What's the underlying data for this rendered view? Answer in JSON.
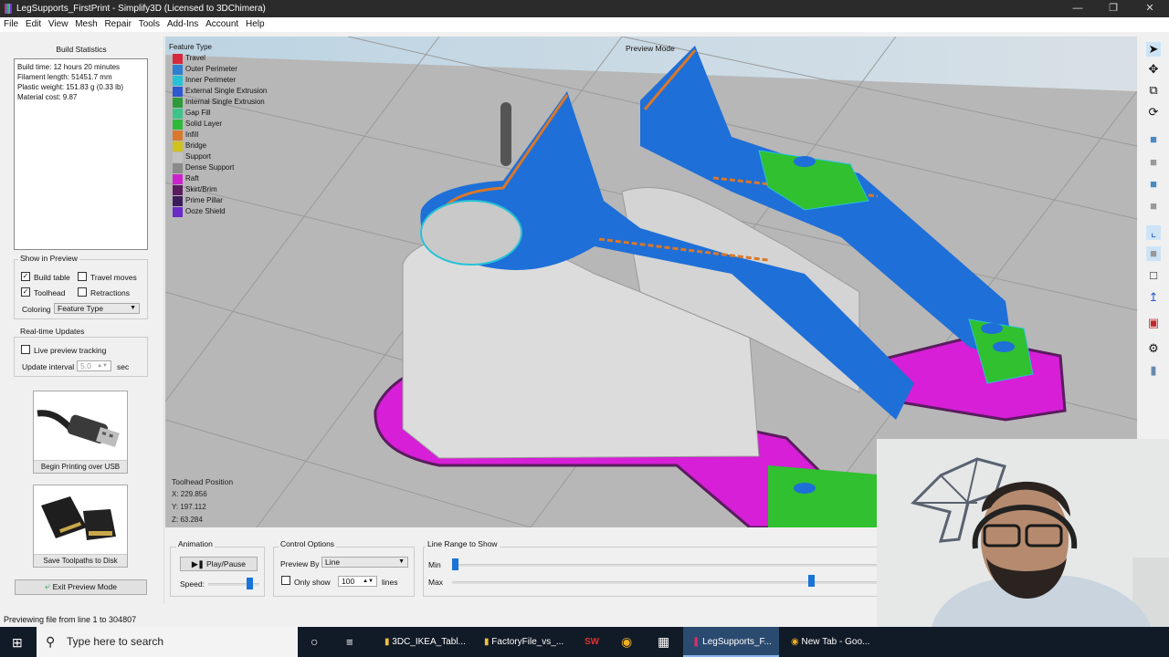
{
  "window": {
    "title": "LegSupports_FirstPrint - Simplify3D (Licensed to 3DChimera)",
    "controls": [
      "minimize",
      "restore",
      "close"
    ]
  },
  "menu": [
    "File",
    "Edit",
    "View",
    "Mesh",
    "Repair",
    "Tools",
    "Add-Ins",
    "Account",
    "Help"
  ],
  "build_statistics": {
    "heading": "Build Statistics",
    "lines": [
      "Build time: 12 hours 20 minutes",
      "Filament length: 51451.7 mm",
      "Plastic weight: 151.83 g (0.33 lb)",
      "Material cost: 9.87"
    ]
  },
  "show_in_preview": {
    "heading": "Show in Preview",
    "build_table": {
      "label": "Build table",
      "checked": true
    },
    "travel_moves": {
      "label": "Travel moves",
      "checked": false
    },
    "toolhead": {
      "label": "Toolhead",
      "checked": true
    },
    "retractions": {
      "label": "Retractions",
      "checked": false
    },
    "coloring_label": "Coloring",
    "coloring_value": "Feature Type"
  },
  "realtime_updates": {
    "heading": "Real-time Updates",
    "live_tracking": {
      "label": "Live preview tracking",
      "checked": false
    },
    "interval_label": "Update interval",
    "interval_value": "5.0",
    "interval_unit": "sec"
  },
  "actions": {
    "usb_label": "Begin Printing over USB",
    "disk_label": "Save Toolpaths to Disk",
    "exit_label": "Exit Preview Mode"
  },
  "status": "Previewing file from line 1 to 304807",
  "viewport": {
    "mode_label": "Preview Mode",
    "legend_title": "Feature Type",
    "legend": [
      {
        "label": "Travel",
        "color": "#d8283c"
      },
      {
        "label": "Outer Perimeter",
        "color": "#2f7fd0"
      },
      {
        "label": "Inner Perimeter",
        "color": "#27c2d6"
      },
      {
        "label": "External Single Extrusion",
        "color": "#2e58d0"
      },
      {
        "label": "Internal Single Extrusion",
        "color": "#2e9a3a"
      },
      {
        "label": "Gap Fill",
        "color": "#3cc48a"
      },
      {
        "label": "Solid Layer",
        "color": "#30b83a"
      },
      {
        "label": "Infill",
        "color": "#d9782a"
      },
      {
        "label": "Bridge",
        "color": "#cfc21c"
      },
      {
        "label": "Support",
        "color": "#c2c2c2"
      },
      {
        "label": "Dense Support",
        "color": "#8a8a8a"
      },
      {
        "label": "Raft",
        "color": "#cc22cc"
      },
      {
        "label": "Skirt/Brim",
        "color": "#5a1c5e"
      },
      {
        "label": "Prime Pillar",
        "color": "#3c1c5c"
      },
      {
        "label": "Ooze Shield",
        "color": "#6a2ac8"
      }
    ],
    "toolhead": {
      "title": "Toolhead Position",
      "x": "X: 229.856",
      "y": "Y: 197.112",
      "z": "Z: 63.284"
    }
  },
  "right_toolbar": [
    "select-icon",
    "move-icon",
    "scale-icon",
    "rotate-icon",
    "view-top-icon",
    "view-front-icon",
    "view-side-icon",
    "view-iso-icon",
    "axes-icon",
    "solid-cube-icon",
    "wireframe-cube-icon",
    "build-table-icon",
    "cross-section-icon",
    "settings-gear-icon",
    "support-pillars-icon"
  ],
  "animation": {
    "heading": "Animation",
    "play_label": "Play/Pause",
    "speed_label": "Speed:",
    "speed_fraction": 0.85
  },
  "control_options": {
    "heading": "Control Options",
    "preview_by_label": "Preview By",
    "preview_by_value": "Line",
    "only_show_label": "Only show",
    "only_show_checked": false,
    "only_show_value": "100",
    "lines_label": "lines"
  },
  "line_range": {
    "heading": "Line Range to Show",
    "min_label": "Min",
    "max_label": "Max",
    "min_fraction": 0.0,
    "max_fraction": 0.85
  },
  "taskbar": {
    "search_placeholder": "Type here to search",
    "items": [
      {
        "label": "3DC_IKEA_Tabl...",
        "icon": "folder-icon"
      },
      {
        "label": "FactoryFile_vs_...",
        "icon": "folder-icon"
      },
      {
        "label": "",
        "icon": "solidworks-icon"
      },
      {
        "label": "",
        "icon": "chrome-icon"
      },
      {
        "label": "",
        "icon": "calculator-icon"
      },
      {
        "label": "LegSupports_F...",
        "icon": "simplify3d-icon",
        "active": true
      },
      {
        "label": "New Tab - Goo...",
        "icon": "chrome-icon"
      }
    ]
  }
}
